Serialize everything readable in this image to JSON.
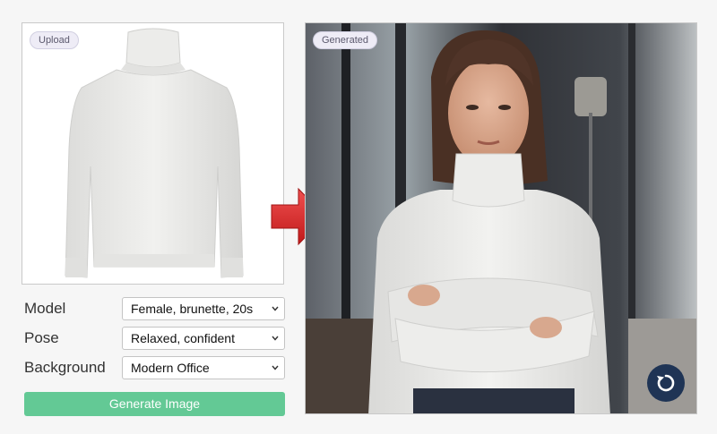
{
  "upload": {
    "tag": "Upload"
  },
  "generated": {
    "tag": "Generated"
  },
  "form": {
    "model": {
      "label": "Model",
      "value": "Female, brunette, 20s"
    },
    "pose": {
      "label": "Pose",
      "value": "Relaxed, confident"
    },
    "background": {
      "label": "Background",
      "value": "Modern Office"
    }
  },
  "generate_button": {
    "label": "Generate Image"
  },
  "icons": {
    "arrow": "right-arrow-icon",
    "chevron": "chevron-down-icon",
    "refresh": "refresh-icon"
  },
  "colors": {
    "generate_button": "#63c995",
    "arrow": "#d62a2a",
    "refresh_button": "#1f3455"
  }
}
